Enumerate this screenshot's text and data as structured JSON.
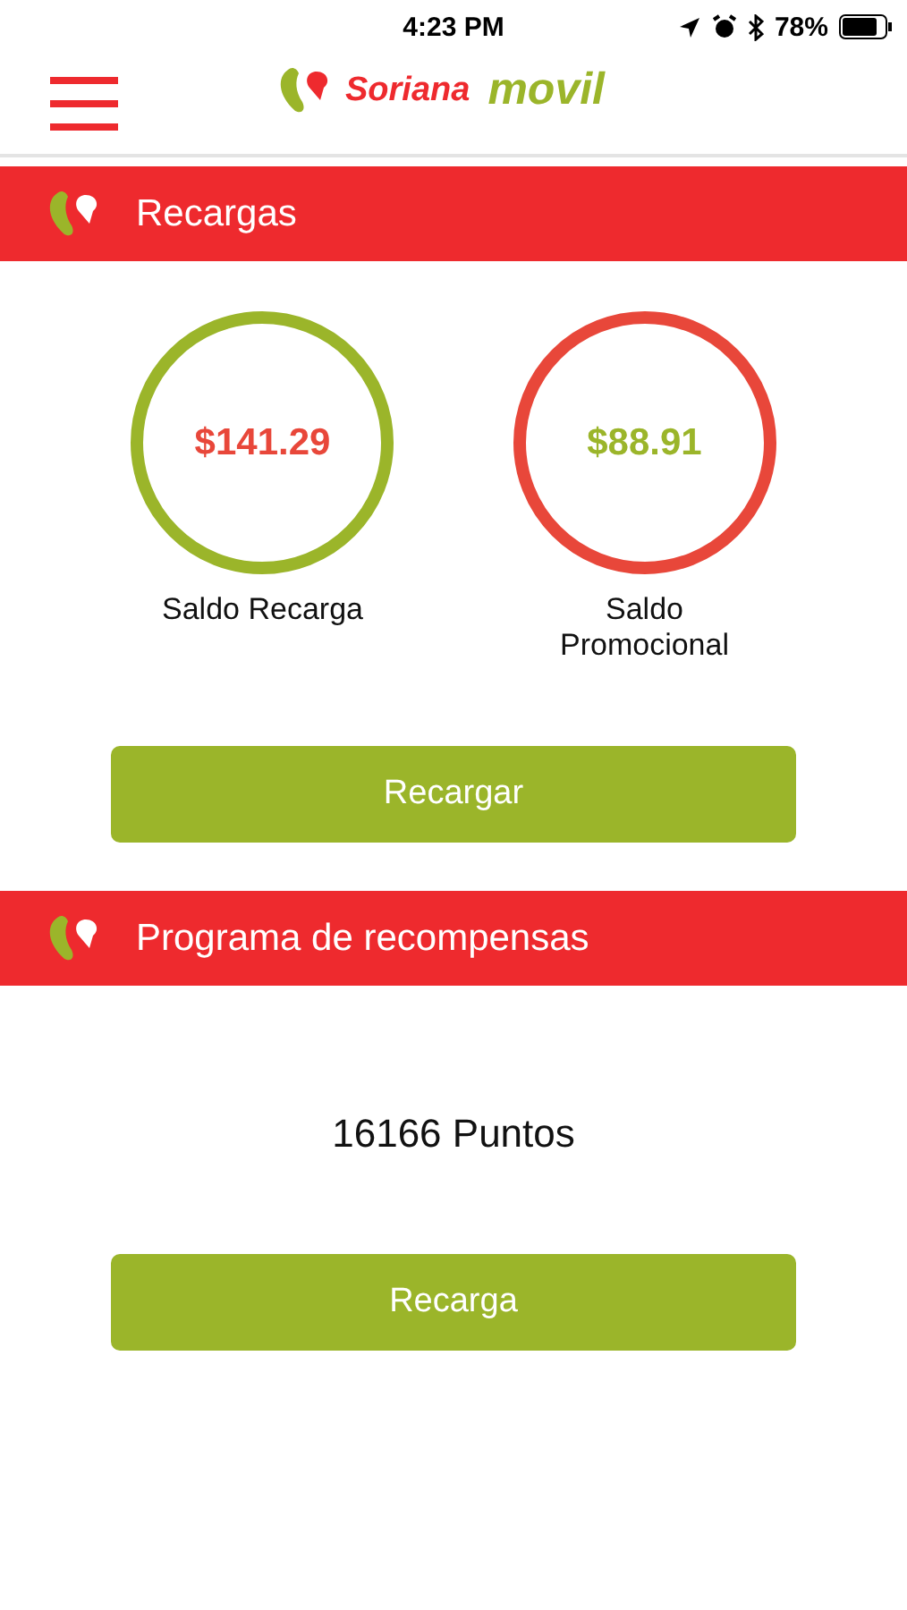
{
  "status_bar": {
    "time": "4:23 PM",
    "battery": "78%"
  },
  "header": {
    "brand": "Soriana",
    "brand_suffix": "movil"
  },
  "sections": [
    {
      "title": "Recargas",
      "kind": "balances",
      "balances": [
        {
          "amount": "$141.29",
          "label": "Saldo Recarga",
          "color": "#9bb52a"
        },
        {
          "amount": "$88.91",
          "label": "Saldo Promocional",
          "color": "#e8473a"
        }
      ],
      "button": "Recargar"
    },
    {
      "title": "Programa de recompensas",
      "kind": "points",
      "points": "16166 Puntos",
      "button": "Recarga"
    }
  ]
}
